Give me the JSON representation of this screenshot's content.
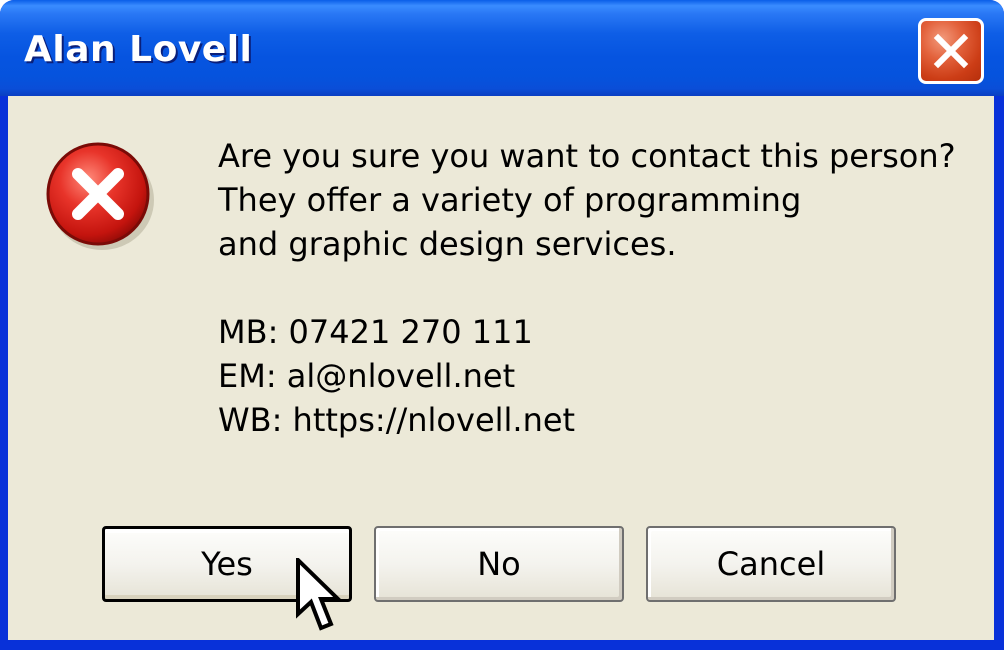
{
  "window": {
    "title": "Alan Lovell",
    "close_icon": "close-x-icon"
  },
  "message": {
    "icon": "error-icon",
    "lines": [
      "Are you sure you want to contact this person?",
      "They offer a variety of programming",
      "and graphic design services."
    ]
  },
  "contact": {
    "mobile": "MB: 07421 270 111",
    "email": "EM: al@nlovell.net",
    "website": "WB: https://nlovell.net"
  },
  "buttons": {
    "yes": "Yes",
    "no": "No",
    "cancel": "Cancel"
  },
  "colors": {
    "titlebar": "#0654e0",
    "dialog_body": "#ece9d8",
    "close_button": "#cc3d16",
    "error_icon": "#d61e1e"
  }
}
